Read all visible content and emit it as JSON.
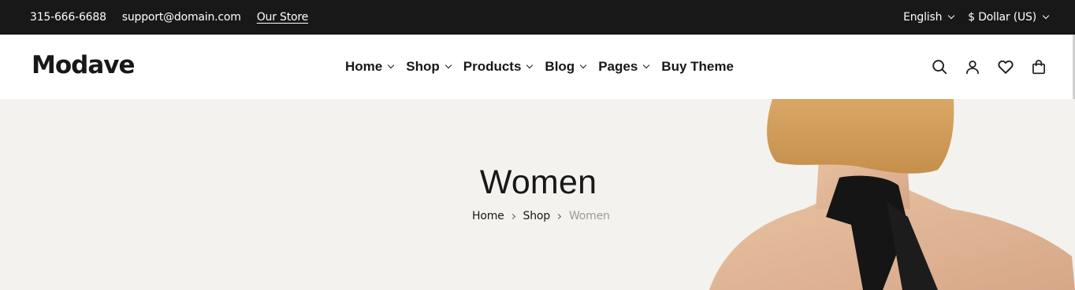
{
  "topbar": {
    "phone": "315-666-6688",
    "email": "support@domain.com",
    "store_link": "Our Store",
    "language": "English",
    "currency": "$ Dollar (US)"
  },
  "header": {
    "logo": "Modave",
    "nav": [
      {
        "label": "Home",
        "has_dropdown": true
      },
      {
        "label": "Shop",
        "has_dropdown": true
      },
      {
        "label": "Products",
        "has_dropdown": true
      },
      {
        "label": "Blog",
        "has_dropdown": true
      },
      {
        "label": "Pages",
        "has_dropdown": true
      },
      {
        "label": "Buy Theme",
        "has_dropdown": false
      }
    ],
    "icons": [
      "search-icon",
      "user-icon",
      "heart-icon",
      "bag-icon"
    ]
  },
  "hero": {
    "title": "Women",
    "breadcrumb": [
      "Home",
      "Shop",
      "Women"
    ]
  },
  "colors": {
    "topbar_bg": "#181818",
    "hero_bg": "#f3f2ee",
    "text": "#181818",
    "breadcrumb_current": "#9a9a9a"
  }
}
